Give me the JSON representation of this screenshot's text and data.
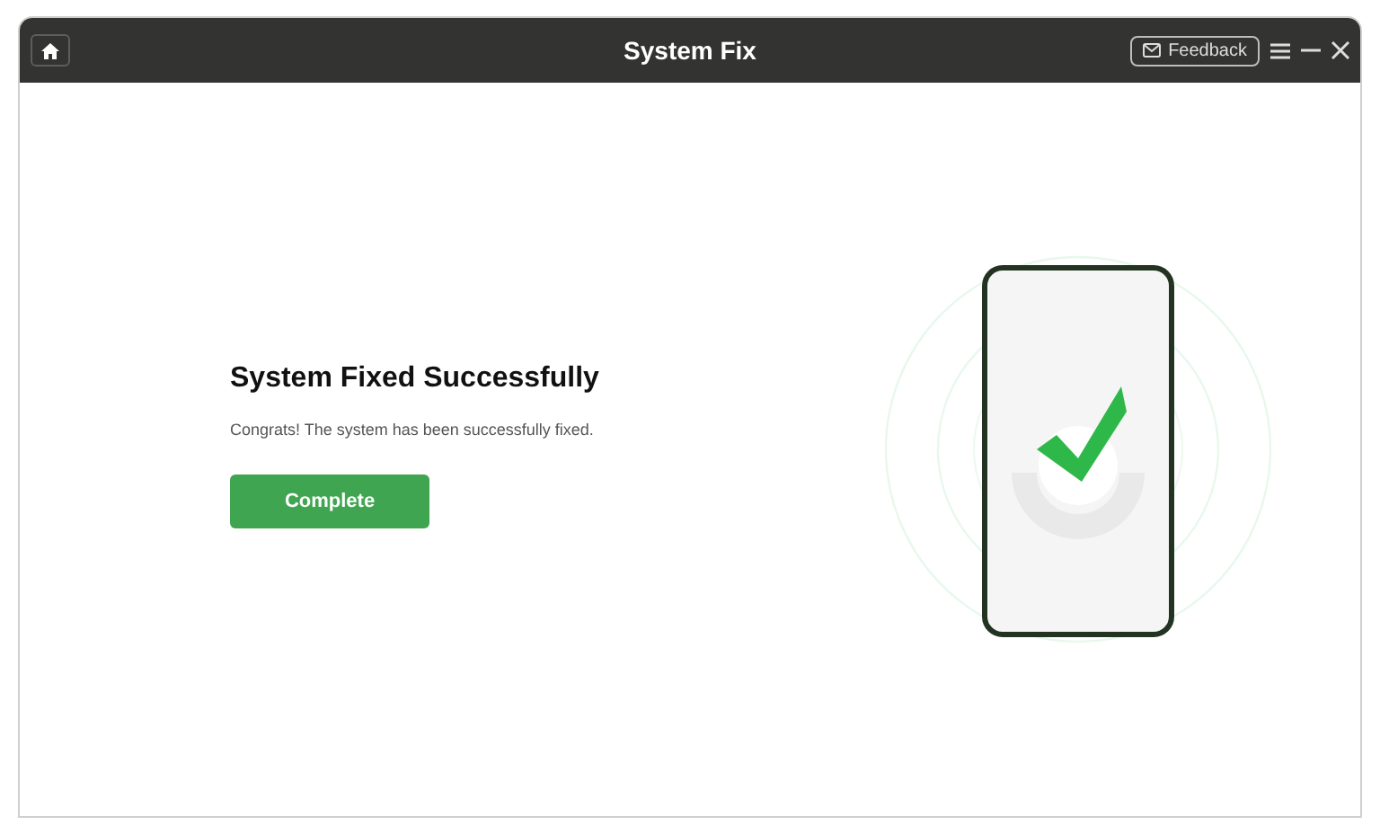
{
  "window": {
    "title": "System Fix"
  },
  "title_bar": {
    "feedback_label": "Feedback"
  },
  "result": {
    "heading": "System Fixed Successfully",
    "message": "Congrats! The system has been successfully fixed.",
    "button": "Complete"
  }
}
